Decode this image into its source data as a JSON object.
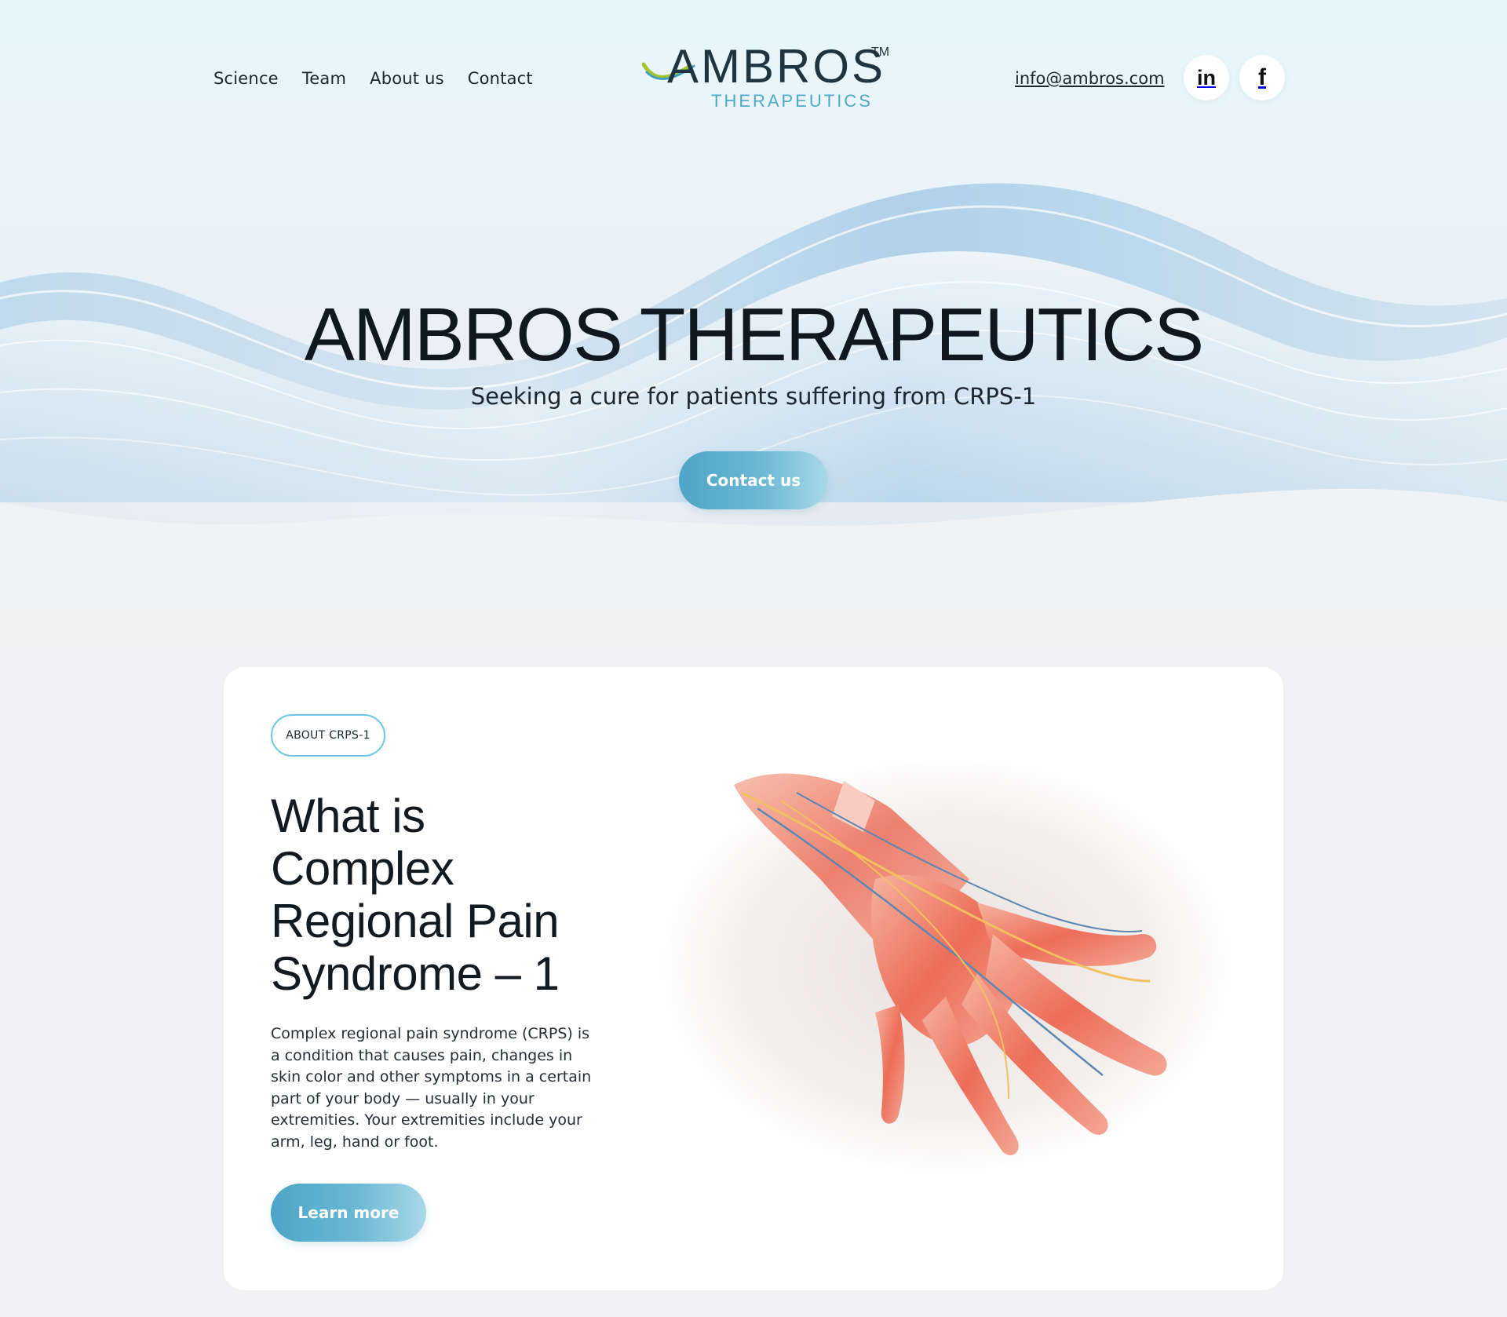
{
  "header": {
    "nav": [
      "Science",
      "Team",
      "About us",
      "Contact"
    ],
    "logo_word": "AMBROS",
    "logo_tm": "TM",
    "logo_sub": "THERAPEUTICS",
    "email": "info@ambros.com",
    "social": [
      {
        "name": "linkedin-icon",
        "glyph": "in"
      },
      {
        "name": "facebook-icon",
        "glyph": "f"
      }
    ]
  },
  "hero": {
    "title": "AMBROS THERAPEUTICS",
    "subtitle": "Seeking a cure for patients suffering from CRPS-1",
    "cta_label": "Contact us"
  },
  "card": {
    "badge": "ABOUT CRPS-1",
    "title": "What is\nComplex\nRegional Pain\nSyndrome – 1",
    "text": "Complex regional pain syndrome (CRPS) is a condition that causes pain, changes in skin color and other symptoms in a certain part of your body — usually in your extremities. Your extremities include your arm, leg, hand or foot.",
    "cta_label": "Learn more",
    "image": "hand-anatomy-illustration"
  },
  "colors": {
    "accent": "#4ea5c6",
    "accent_light": "#a9d9e8",
    "badge_border": "#6cc8e6",
    "text_dark": "#121a21",
    "page_bg": "#f1f1f3"
  }
}
